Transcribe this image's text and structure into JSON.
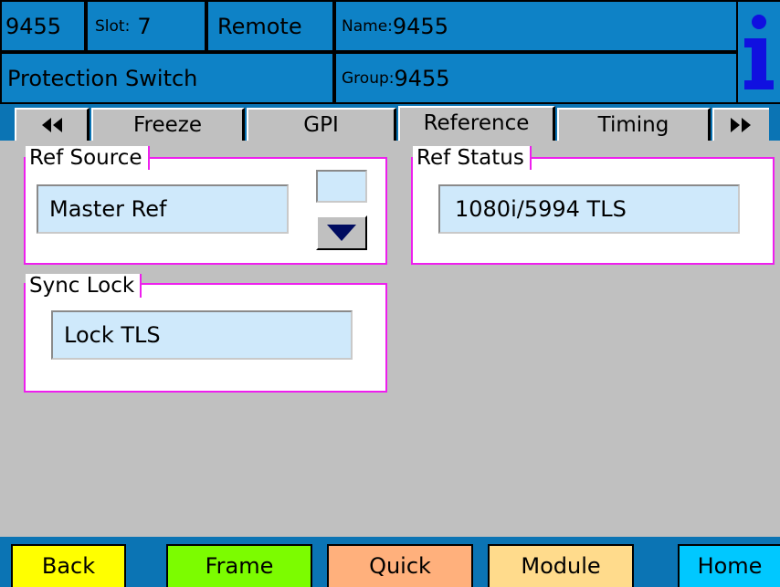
{
  "header": {
    "id": "9455",
    "slot_label": "Slot:",
    "slot_value": "7",
    "mode": "Remote",
    "name_label": "Name:",
    "name_value": "9455",
    "title": "Protection Switch",
    "group_label": "Group:",
    "group_value": "9455",
    "info_icon": "info-icon"
  },
  "tabs": {
    "prev_icon": "double-left-arrow-icon",
    "next_icon": "double-right-arrow-icon",
    "items": [
      {
        "label": "Freeze"
      },
      {
        "label": "GPI"
      },
      {
        "label": "Reference"
      },
      {
        "label": "Timing"
      }
    ],
    "active": "Reference"
  },
  "panels": {
    "ref_source": {
      "label": "Ref Source",
      "value": "Master Ref"
    },
    "ref_status": {
      "label": "Ref Status",
      "value": "1080i/5994 TLS"
    },
    "sync_lock": {
      "label": "Sync Lock",
      "value": "Lock TLS"
    }
  },
  "bottom": {
    "back": "Back",
    "frame": "Frame",
    "quick": "Quick",
    "module": "Module",
    "home": "Home"
  },
  "colors": {
    "header_bg": "#0b74b4",
    "panel_border": "#ee1fee",
    "field_bg": "#cfe9fb",
    "back": "#ffff00",
    "frame": "#7cfc00",
    "quick": "#ffb07c",
    "module": "#ffdb8c",
    "home": "#00c8ff"
  }
}
